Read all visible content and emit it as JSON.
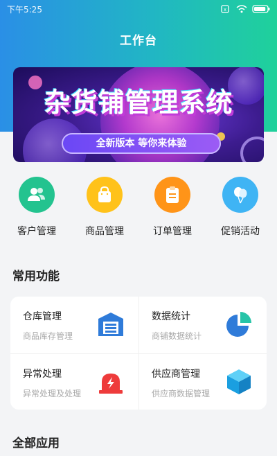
{
  "status_bar": {
    "time": "下午5:25",
    "battery_level": 0.9
  },
  "header": {
    "title": "工作台"
  },
  "banner": {
    "title": "杂货铺管理系统",
    "subtitle": "全新版本 等你来体验"
  },
  "quick_actions": [
    {
      "label": "客户管理",
      "icon": "customer-icon",
      "color": "#23c38f"
    },
    {
      "label": "商品管理",
      "icon": "shopping-bag-icon",
      "color": "#ffc21a"
    },
    {
      "label": "订单管理",
      "icon": "clipboard-icon",
      "color": "#ff9418"
    },
    {
      "label": "促销活动",
      "icon": "balloons-icon",
      "color": "#3fb4f4"
    }
  ],
  "common_functions": {
    "title": "常用功能",
    "items": [
      {
        "title": "仓库管理",
        "subtitle": "商品库存管理",
        "icon": "warehouse-icon",
        "color": "#2f7bd9"
      },
      {
        "title": "数据统计",
        "subtitle": "商铺数据统计",
        "icon": "pie-chart-icon",
        "color": "#2f7bd9"
      },
      {
        "title": "异常处理",
        "subtitle": "异常处理及处理",
        "icon": "alarm-icon",
        "color": "#ee3b3b"
      },
      {
        "title": "供应商管理",
        "subtitle": "供应商数据管理",
        "icon": "box-icon",
        "color": "#1a9fe0"
      }
    ]
  },
  "all_apps": {
    "title": "全部应用"
  }
}
